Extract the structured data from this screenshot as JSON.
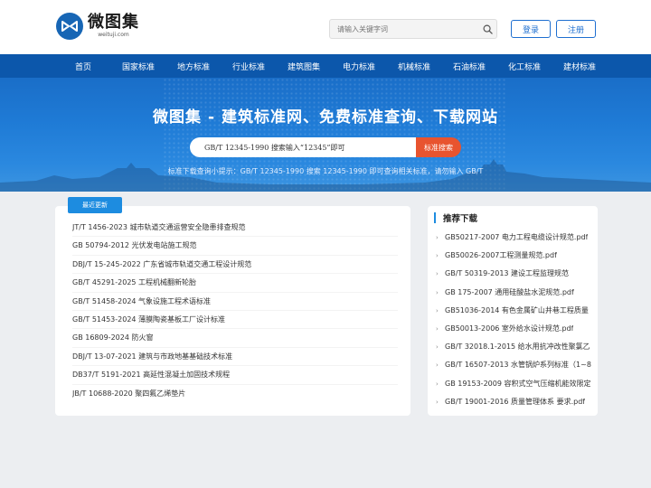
{
  "header": {
    "logo_text": "微图集",
    "logo_sub": "weituji.com",
    "search_placeholder": "请输入关键字词",
    "login_label": "登录",
    "register_label": "注册"
  },
  "nav": {
    "items": [
      "首页",
      "国家标准",
      "地方标准",
      "行业标准",
      "建筑图集",
      "电力标准",
      "机械标准",
      "石油标准",
      "化工标准",
      "建材标准"
    ]
  },
  "banner": {
    "title": "微图集 - 建筑标准网、免费标准查询、下载网站",
    "search_value": "GB/T 12345-1990 搜索输入“12345”即可",
    "search_button": "标准搜索",
    "tip": "标准下载查询小提示：GB/T 12345-1990 搜索 12345-1990 即可查询相关标准，请勿输入 GB/T"
  },
  "latest": {
    "tab_label": "最近更新",
    "items": [
      "JT/T 1456-2023 城市轨道交通运营安全隐患排查规范",
      "GB 50794-2012 光伏发电站施工规范",
      "DBJ/T 15-245-2022 广东省城市轨道交通工程设计规范",
      "GB/T 45291-2025 工程机械翻新轮胎",
      "GB/T 51458-2024 气象设施工程术语标准",
      "GB/T 51453-2024 薄膜陶瓷基板工厂设计标准",
      "GB 16809-2024 防火窗",
      "DBJ/T 13-07-2021 建筑与市政地基基础技术标准",
      "DB37/T 5191-2021 高延性混凝土加固技术规程",
      "JB/T 10688-2020 聚四氟乙烯垫片"
    ]
  },
  "recommended": {
    "title": "推荐下载",
    "items": [
      "GB50217-2007 电力工程电缆设计规范.pdf",
      "GB50026-2007工程测量规范.pdf",
      "GB/T 50319-2013 建设工程监理规范",
      "GB 175-2007 通用硅酸盐水泥规范.pdf",
      "GB51036-2014 有色金属矿山井巷工程质量",
      "GB50013-2006 室外给水设计规范.pdf",
      "GB/T 32018.1-2015 给水用抗冲改性聚氯乙",
      "GB/T 16507-2013 水管锅炉系列标准（1~8",
      "GB 19153-2009 容积式空气压缩机能效限定",
      "GB/T 19001-2016 质量管理体系 要求.pdf"
    ]
  },
  "colors": {
    "nav_bg": "#0c57ab",
    "accent": "#1d8ce0",
    "search_button": "#e8542f",
    "logo": "#1766b5"
  },
  "icons": {
    "logo": "logo-mark-icon",
    "search": "search-icon",
    "list_arrow": "chevron-right-icon"
  }
}
